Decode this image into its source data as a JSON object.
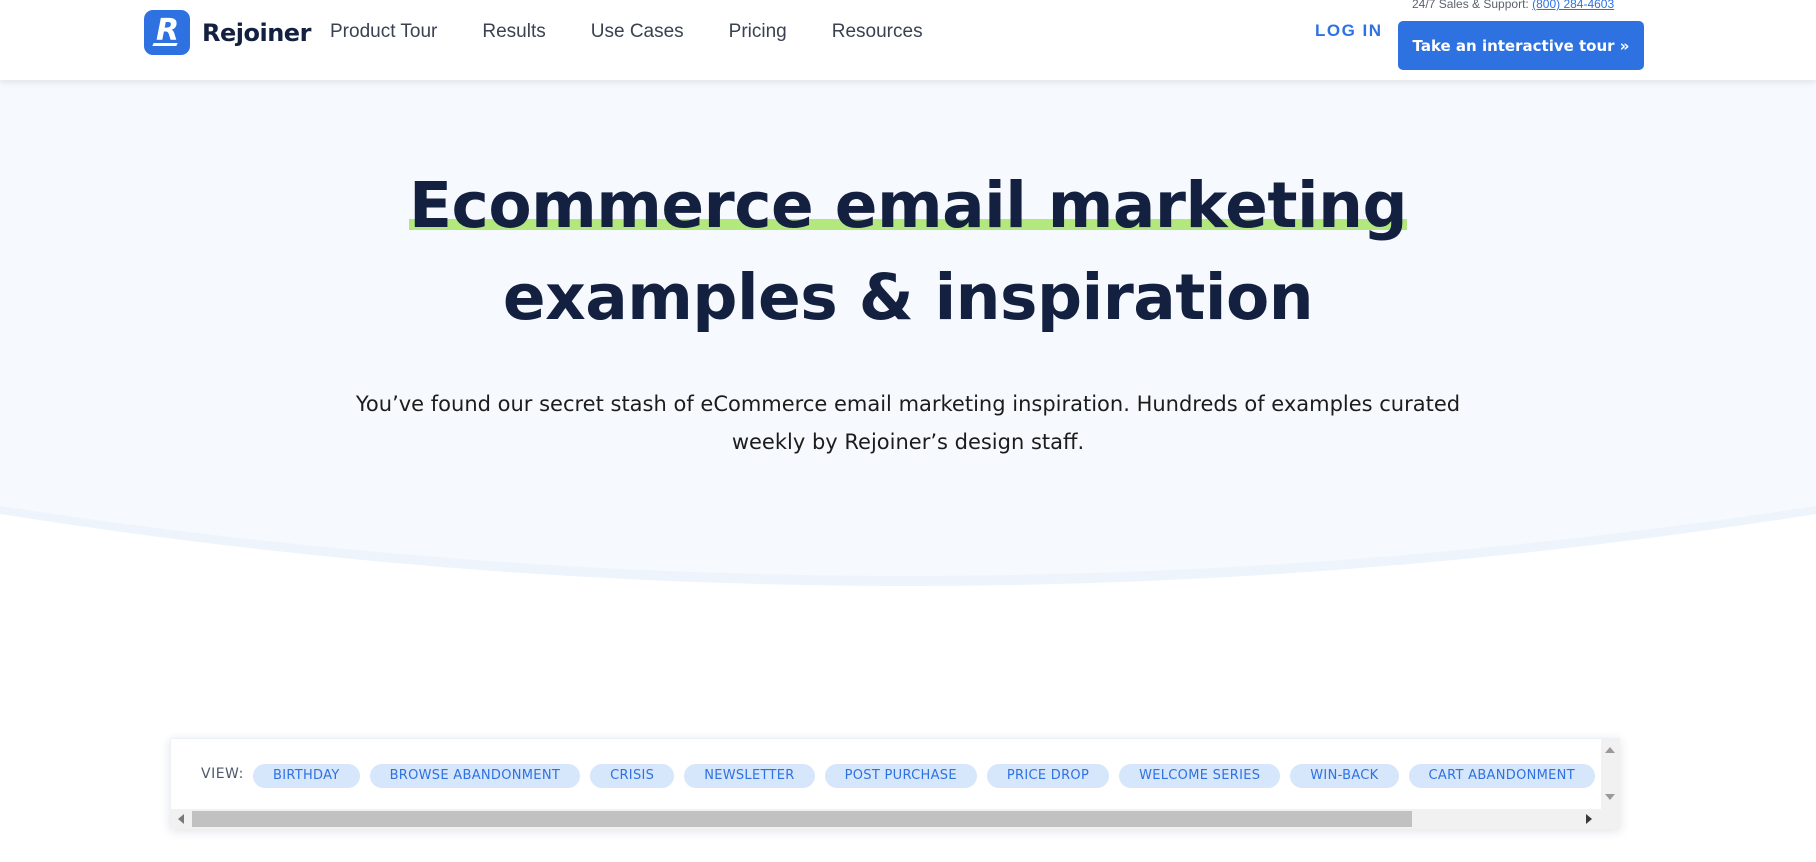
{
  "header": {
    "brand": "Rejoiner",
    "logo_letter": "R",
    "nav": [
      {
        "label": "Product Tour"
      },
      {
        "label": "Results"
      },
      {
        "label": "Use Cases"
      },
      {
        "label": "Pricing"
      },
      {
        "label": "Resources"
      }
    ],
    "support_text": "24/7 Sales & Support:",
    "support_phone": "(800) 284-4603",
    "login_label": "LOG IN",
    "cta_label": "Take an interactive tour »"
  },
  "hero": {
    "title_highlight": "Ecommerce email marketing",
    "title_rest": "examples & inspiration",
    "subtitle": "You’ve found our secret stash of eCommerce email marketing inspiration. Hundreds of examples curated weekly by Rejoiner’s design staff."
  },
  "filter": {
    "view_label": "VIEW:",
    "chips": [
      "BIRTHDAY",
      "BROWSE ABANDONMENT",
      "CRISIS",
      "NEWSLETTER",
      "POST PURCHASE",
      "PRICE DROP",
      "WELCOME SERIES",
      "WIN-BACK",
      "CART ABANDONMENT"
    ]
  },
  "colors": {
    "brand": "#2e72e2",
    "heading": "#13203f",
    "highlight": "#b2e87e",
    "hero_bg": "#f6f9fd",
    "chip_bg": "#d6e6fb"
  },
  "icons": [
    "logo-mark-icon",
    "scroll-up-arrow-icon",
    "scroll-down-arrow-icon",
    "scroll-left-arrow-icon",
    "scroll-right-arrow-icon"
  ]
}
